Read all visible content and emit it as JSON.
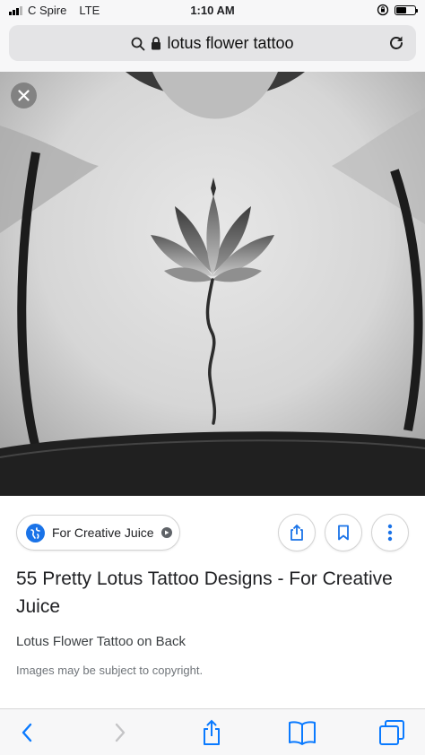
{
  "status_bar": {
    "carrier": "C Spire",
    "network": "LTE",
    "time": "1:10 AM",
    "battery_level": 0.55
  },
  "url_bar": {
    "query": "lotus flower tattoo"
  },
  "hero_image": {
    "icon": "lotus-back-tattoo-photo"
  },
  "result": {
    "source": "For Creative Juice",
    "title": "55 Pretty Lotus Tattoo Designs - For Creative Juice",
    "subtitle": "Lotus Flower Tattoo on Back",
    "copyright": "Images may be subject to copyright."
  },
  "colors": {
    "accent_blue": "#1a73e8",
    "browser_blue": "#0a7aff",
    "browser_gray": "#c4c4c6"
  }
}
